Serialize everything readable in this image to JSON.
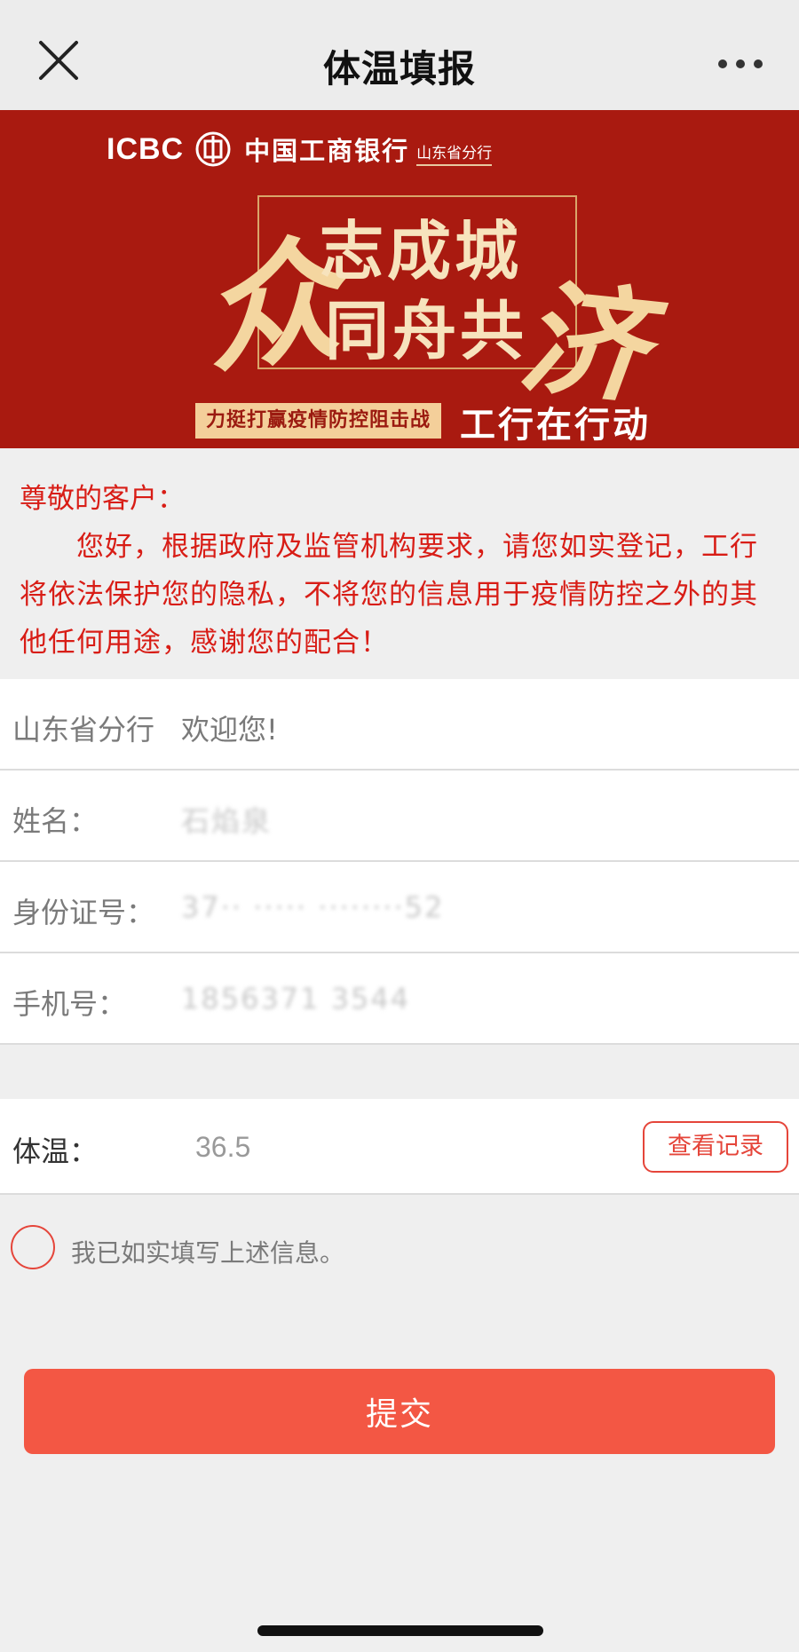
{
  "nav": {
    "title": "体温填报",
    "close_icon": "close-icon",
    "more_icon": "more-icon"
  },
  "banner": {
    "brand": "ICBC",
    "bank_name": "中国工商银行",
    "branch": "山东省分行",
    "char_left": "众",
    "line_1": "志成城",
    "line_2": "同舟共",
    "char_right": "济",
    "slogan": "力挺打赢疫情防控阻击战",
    "action": "工行在行动",
    "colors": {
      "background": "#a91a10",
      "gold": "#f4d6a0"
    }
  },
  "notice": {
    "greeting": "尊敬的客户：",
    "body": "您好，根据政府及监管机构要求，请您如实登记，工行将依法保护您的隐私，不将您的信息用于疫情防控之外的其他任何用途，感谢您的配合！",
    "color": "#d81d16"
  },
  "form": {
    "welcome": {
      "label": "山东省分行",
      "value": "欢迎您!"
    },
    "name": {
      "label": "姓名：",
      "value": "石焰泉"
    },
    "id_number": {
      "label": "身份证号：",
      "value": "37·· ····· ········52"
    },
    "phone": {
      "label": "手机号：",
      "value": "1856371 3544"
    }
  },
  "temperature": {
    "label": "体温：",
    "value": "36.5",
    "records_button": "查看记录"
  },
  "confirm": {
    "text": "我已如实填写上述信息。",
    "checked": false
  },
  "submit": {
    "label": "提交",
    "color": "#f35744"
  }
}
